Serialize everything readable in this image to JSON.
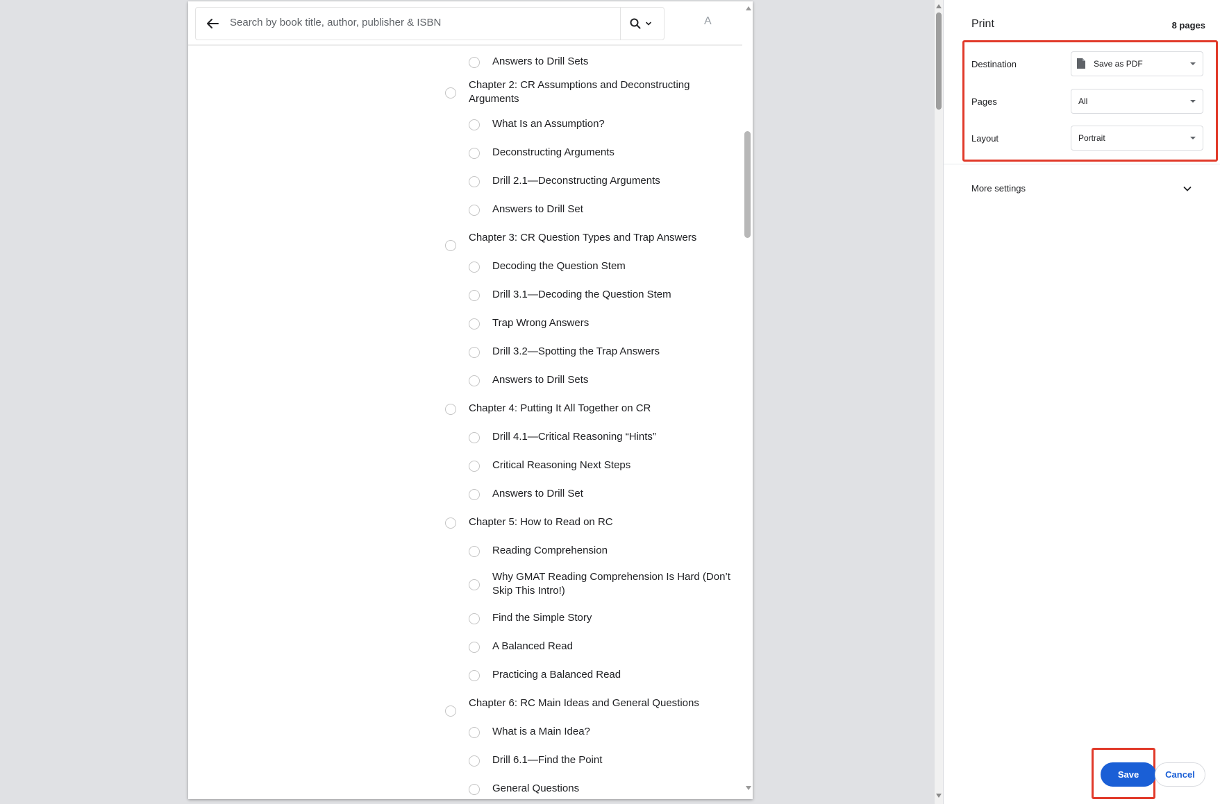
{
  "search": {
    "placeholder": "Search by book title, author, publisher & ISBN",
    "letter_button": "A"
  },
  "toc": [
    {
      "level": "section",
      "label": "Answers to Drill Sets"
    },
    {
      "level": "chapter",
      "label": "Chapter 2: CR Assumptions and Deconstructing Arguments"
    },
    {
      "level": "section",
      "label": "What Is an Assumption?"
    },
    {
      "level": "section",
      "label": "Deconstructing Arguments"
    },
    {
      "level": "section",
      "label": "Drill 2.1—Deconstructing Arguments"
    },
    {
      "level": "section",
      "label": "Answers to Drill Set"
    },
    {
      "level": "chapter",
      "label": "Chapter 3: CR Question Types and Trap Answers"
    },
    {
      "level": "section",
      "label": "Decoding the Question Stem"
    },
    {
      "level": "section",
      "label": "Drill 3.1—Decoding the Question Stem"
    },
    {
      "level": "section",
      "label": "Trap Wrong Answers"
    },
    {
      "level": "section",
      "label": "Drill 3.2—Spotting the Trap Answers"
    },
    {
      "level": "section",
      "label": "Answers to Drill Sets"
    },
    {
      "level": "chapter",
      "label": "Chapter 4: Putting It All Together on CR"
    },
    {
      "level": "section",
      "label": "Drill 4.1—Critical Reasoning “Hints”"
    },
    {
      "level": "section",
      "label": "Critical Reasoning Next Steps"
    },
    {
      "level": "section",
      "label": "Answers to Drill Set"
    },
    {
      "level": "chapter",
      "label": "Chapter 5: How to Read on RC"
    },
    {
      "level": "section",
      "label": "Reading Comprehension"
    },
    {
      "level": "section",
      "label": "Why GMAT Reading Comprehension Is Hard (Don’t Skip This Intro!)"
    },
    {
      "level": "section",
      "label": "Find the Simple Story"
    },
    {
      "level": "section",
      "label": "A Balanced Read"
    },
    {
      "level": "section",
      "label": "Practicing a Balanced Read"
    },
    {
      "level": "chapter",
      "label": "Chapter 6: RC Main Ideas and General Questions"
    },
    {
      "level": "section",
      "label": "What is a Main Idea?"
    },
    {
      "level": "section",
      "label": "Drill 6.1—Find the Point"
    },
    {
      "level": "section",
      "label": "General Questions"
    }
  ],
  "print": {
    "title": "Print",
    "page_count": "8 pages",
    "destination": {
      "label": "Destination",
      "value": "Save as PDF"
    },
    "pages": {
      "label": "Pages",
      "value": "All"
    },
    "layout": {
      "label": "Layout",
      "value": "Portrait"
    },
    "more_settings": "More settings",
    "save_label": "Save",
    "cancel_label": "Cancel"
  },
  "colors": {
    "accent": "#1a5fd6",
    "highlight": "#e13a2a"
  }
}
